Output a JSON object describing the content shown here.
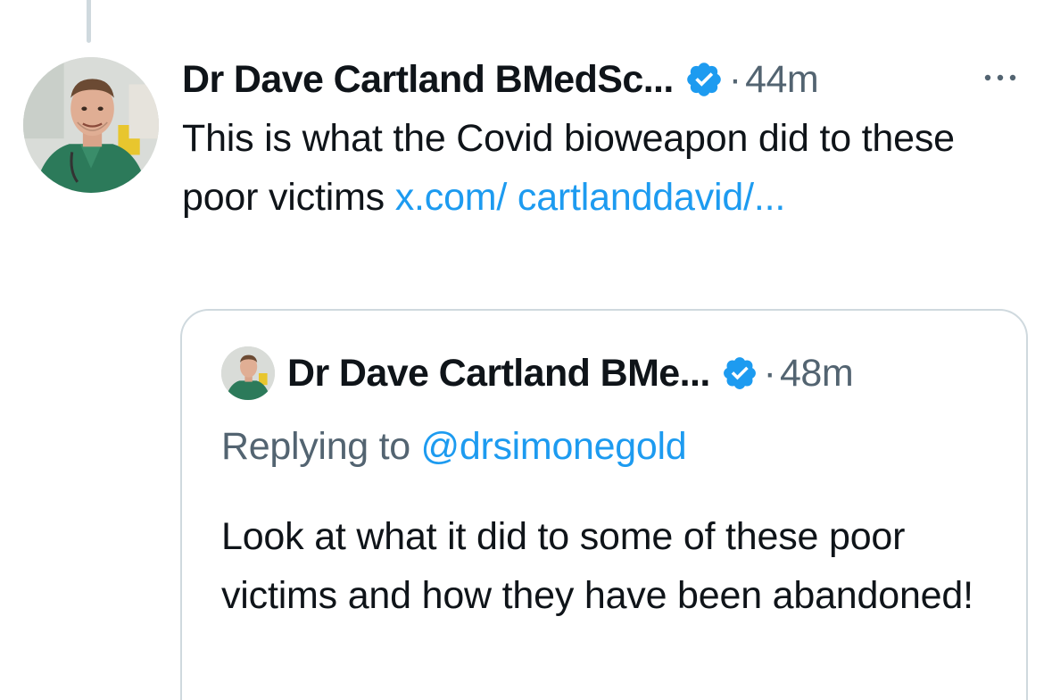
{
  "tweet": {
    "author_name": "Dr Dave Cartland BMedSc...",
    "separator": "·",
    "time": "44m",
    "text_plain": "This is what the Covid bioweapon did to these poor victims ",
    "link_text": "x.com/ cartlanddavid/...",
    "more_icon": "more-horizontal-icon",
    "verified_icon": "verified-badge-icon"
  },
  "quote": {
    "author_name": "Dr Dave Cartland BMe...",
    "separator": "·",
    "time": "48m",
    "replying_prefix": "Replying to ",
    "replying_handle": "@drsimonegold",
    "text": "Look at what it did to some of these poor victims and how they have been abandoned!"
  },
  "colors": {
    "link": "#1d9bf0",
    "secondary_text": "#536471",
    "primary_text": "#0f1419",
    "border": "#cfd9de",
    "verified": "#1d9bf0"
  }
}
